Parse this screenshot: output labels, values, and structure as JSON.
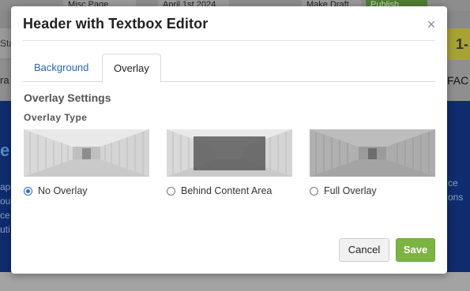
{
  "background_page": {
    "top_tab": "Misc Page",
    "top_date": "April 1st 2024",
    "top_draft": "Make Draft",
    "top_publish": "Publish",
    "left_strip": "Sta",
    "right_yellow": "1-",
    "nav_left": "ra",
    "nav_right": "FAC",
    "hero_left": "e",
    "hero_left_lines": [
      "ap",
      "ou",
      "ce",
      "uti"
    ],
    "hero_right_lines": [
      "ce",
      "ons"
    ]
  },
  "modal": {
    "title": "Header with Textbox Editor",
    "close_icon": "×",
    "tabs": [
      {
        "label": "Background",
        "active": false
      },
      {
        "label": "Overlay",
        "active": true
      }
    ],
    "section_title": "Overlay Settings",
    "field_label": "Overlay Type",
    "options": [
      {
        "label": "No Overlay",
        "checked": true
      },
      {
        "label": "Behind Content Area",
        "checked": false
      },
      {
        "label": "Full Overlay",
        "checked": false
      }
    ],
    "cancel_label": "Cancel",
    "save_label": "Save"
  },
  "colors": {
    "accent_link": "#2a65b0",
    "save_green": "#7cb342",
    "radio_blue": "#2a6fd8",
    "hero_navy": "#0e2c6e"
  }
}
